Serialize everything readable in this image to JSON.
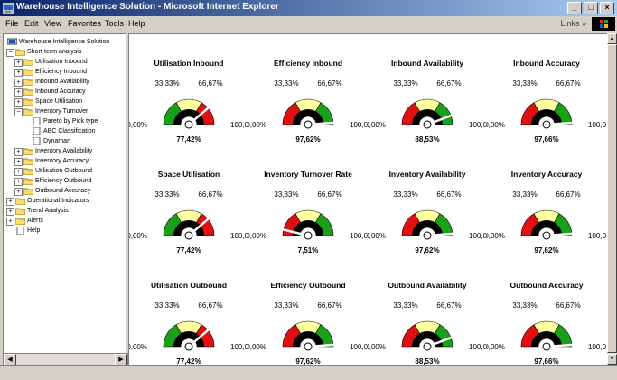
{
  "window": {
    "title": "Warehouse Intelligence Solution - Microsoft Internet Explorer",
    "buttons": [
      "_",
      "□",
      "×"
    ]
  },
  "menubar": {
    "items": [
      "File",
      "Edit",
      "View",
      "Favorites",
      "Tools",
      "Help"
    ],
    "links_label": "Links »"
  },
  "tree": {
    "items": [
      {
        "label": "Warehouse Intelligence Solution",
        "level": 0,
        "expander": "",
        "icon": "computer-icon"
      },
      {
        "label": "Short-term analysis",
        "level": 1,
        "expander": "−",
        "icon": "folder-open-icon"
      },
      {
        "label": "Utilisation Inbound",
        "level": 2,
        "expander": "+",
        "icon": "folder-icon"
      },
      {
        "label": "Efficiency Inbound",
        "level": 2,
        "expander": "+",
        "icon": "folder-icon"
      },
      {
        "label": "Inbound Availability",
        "level": 2,
        "expander": "+",
        "icon": "folder-icon"
      },
      {
        "label": "Inbound Accuracy",
        "level": 2,
        "expander": "+",
        "icon": "folder-icon"
      },
      {
        "label": "Space Utilisation",
        "level": 2,
        "expander": "+",
        "icon": "folder-icon"
      },
      {
        "label": "Inventory Turnover",
        "level": 2,
        "expander": "−",
        "icon": "folder-open-icon"
      },
      {
        "label": "Pareto by Pick type",
        "level": 3,
        "expander": "",
        "icon": "document-icon"
      },
      {
        "label": "ABC Classification",
        "level": 3,
        "expander": "",
        "icon": "document-icon"
      },
      {
        "label": "Dynamart",
        "level": 3,
        "expander": "",
        "icon": "document-icon"
      },
      {
        "label": "Inventory Availability",
        "level": 2,
        "expander": "+",
        "icon": "folder-icon"
      },
      {
        "label": "Inventory Accuracy",
        "level": 2,
        "expander": "+",
        "icon": "folder-icon"
      },
      {
        "label": "Utilisation Outbound",
        "level": 2,
        "expander": "+",
        "icon": "folder-icon"
      },
      {
        "label": "Efficiency Outbound",
        "level": 2,
        "expander": "+",
        "icon": "folder-icon"
      },
      {
        "label": "Outbound Accuracy",
        "level": 2,
        "expander": "+",
        "icon": "folder-icon"
      },
      {
        "label": "Operational Indicators",
        "level": 1,
        "expander": "+",
        "icon": "folder-icon"
      },
      {
        "label": "Trend Analysis",
        "level": 1,
        "expander": "+",
        "icon": "folder-icon"
      },
      {
        "label": "Alerts",
        "level": 1,
        "expander": "+",
        "icon": "folder-icon"
      },
      {
        "label": "Help",
        "level": 1,
        "expander": "",
        "icon": "document-icon"
      }
    ]
  },
  "gauge_scale": {
    "min": "0,00%",
    "low": "33,33%",
    "high": "66,67%",
    "max": "100,00%"
  },
  "gauges": [
    {
      "title": "Utilisation Inbound",
      "value": 77.42,
      "value_label": "77,42%",
      "scheme": "rg"
    },
    {
      "title": "Efficiency Inbound",
      "value": 97.62,
      "value_label": "97,62%",
      "scheme": "gr"
    },
    {
      "title": "Inbound Availability",
      "value": 88.53,
      "value_label": "88,53%",
      "scheme": "gr"
    },
    {
      "title": "Inbound Accuracy",
      "value": 97.66,
      "value_label": "97,66%",
      "scheme": "gr"
    },
    {
      "title": "Space Utilisation",
      "value": 77.42,
      "value_label": "77,42%",
      "scheme": "rg"
    },
    {
      "title": "Inventory Turnover Rate",
      "value": 7.51,
      "value_label": "7,51%",
      "scheme": "gr"
    },
    {
      "title": "Inventory Availability",
      "value": 97.62,
      "value_label": "97,62%",
      "scheme": "gr"
    },
    {
      "title": "Inventory Accuracy",
      "value": 97.62,
      "value_label": "97,62%",
      "scheme": "gr"
    },
    {
      "title": "Utilisation Outbound",
      "value": 77.42,
      "value_label": "77,42%",
      "scheme": "rg"
    },
    {
      "title": "Efficiency Outbound",
      "value": 97.62,
      "value_label": "97,62%",
      "scheme": "gr"
    },
    {
      "title": "Outbound Availability",
      "value": 88.53,
      "value_label": "88,53%",
      "scheme": "gr"
    },
    {
      "title": "Outbound Accuracy",
      "value": 97.66,
      "value_label": "97,66%",
      "scheme": "gr"
    }
  ],
  "colors": {
    "red": "#e01010",
    "yellow": "#ffffa0",
    "green": "#18a018",
    "needle": "#ffffff",
    "title_bar": "#0a246a"
  }
}
